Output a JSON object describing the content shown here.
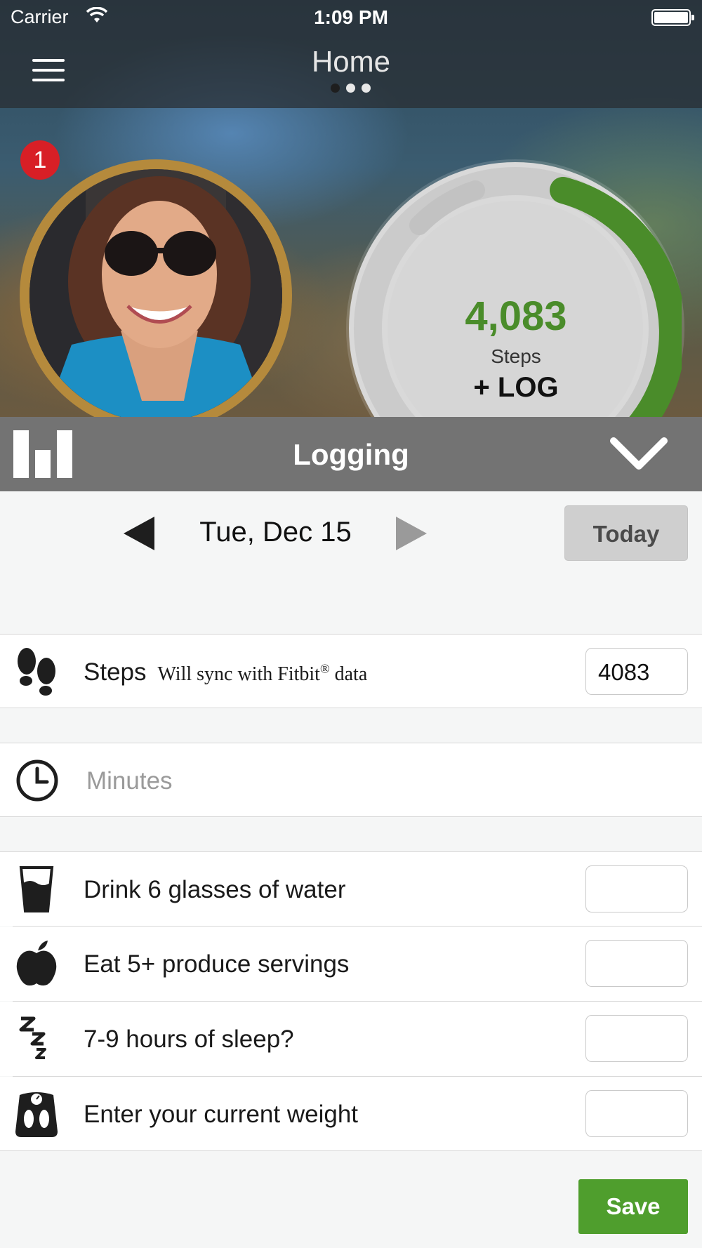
{
  "status_bar": {
    "carrier": "Carrier",
    "time": "1:09 PM"
  },
  "header": {
    "title": "Home",
    "page_dots": 3,
    "active_dot": 0
  },
  "notification": {
    "count": "1"
  },
  "steps_ring": {
    "value": "4,083",
    "label": "Steps",
    "action": "+ LOG",
    "progress_color": "#4a8c2a"
  },
  "logging_bar": {
    "title": "Logging"
  },
  "date_nav": {
    "date": "Tue, Dec 15",
    "today_label": "Today"
  },
  "rows": {
    "steps": {
      "label": "Steps",
      "sub_text": "Will sync with Fitbit",
      "sub_mark": "®",
      "sub_tail": " data",
      "value": "4083"
    },
    "minutes": {
      "placeholder": "Minutes"
    },
    "water": {
      "label": "Drink 6 glasses of water",
      "value": ""
    },
    "produce": {
      "label": "Eat 5+ produce servings",
      "value": ""
    },
    "sleep": {
      "label": "7-9 hours of sleep?",
      "value": ""
    },
    "weight": {
      "label": "Enter your current weight",
      "value": ""
    }
  },
  "actions": {
    "save_label": "Save"
  },
  "colors": {
    "accent_green": "#4f9e2d",
    "badge_red": "#d81f26",
    "avatar_ring": "#b58a3c"
  }
}
